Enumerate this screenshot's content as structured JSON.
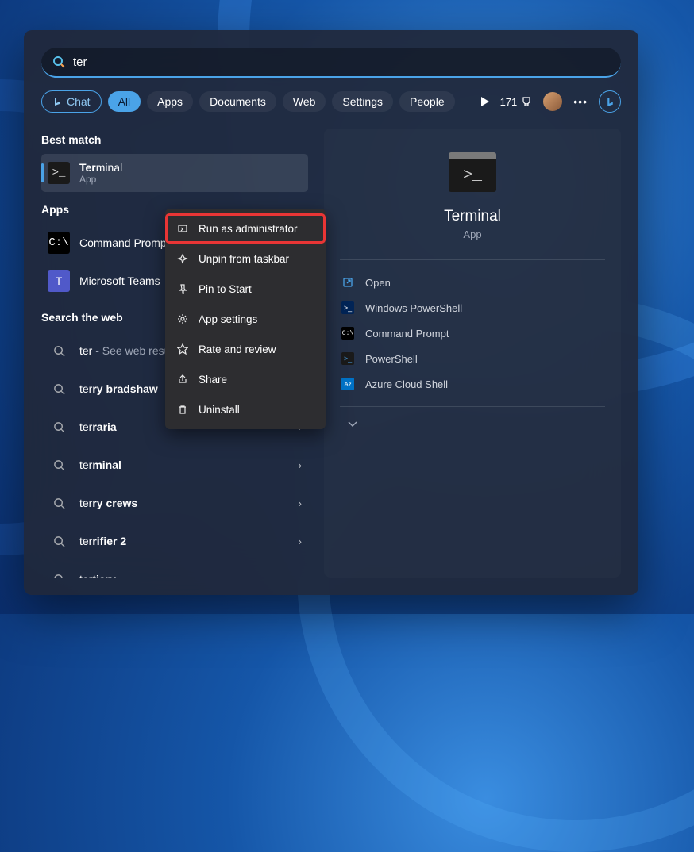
{
  "search": {
    "query": "ter"
  },
  "filters": {
    "chat": "Chat",
    "all": "All",
    "apps": "Apps",
    "documents": "Documents",
    "web": "Web",
    "settings": "Settings",
    "people": "People"
  },
  "header": {
    "points": "171"
  },
  "sections": {
    "best_match": "Best match",
    "apps": "Apps",
    "search_web": "Search the web"
  },
  "best_match": {
    "title_prefix": "Ter",
    "title_rest": "minal",
    "subtitle": "App"
  },
  "apps_results": [
    {
      "name": "Command Prompt",
      "icon": "cmd"
    },
    {
      "name": "Microsoft Teams",
      "icon": "teams"
    }
  ],
  "web_results": [
    {
      "prefix": "ter",
      "bold": "",
      "hint": " - See web results"
    },
    {
      "prefix": "ter",
      "bold": "ry bradshaw",
      "hint": ""
    },
    {
      "prefix": "ter",
      "bold": "raria",
      "hint": ""
    },
    {
      "prefix": "ter",
      "bold": "minal",
      "hint": ""
    },
    {
      "prefix": "ter",
      "bold": "ry crews",
      "hint": ""
    },
    {
      "prefix": "ter",
      "bold": "rifier 2",
      "hint": ""
    },
    {
      "prefix": "ter",
      "bold": "tiary",
      "hint": ""
    }
  ],
  "context_menu": [
    {
      "label": "Run as administrator",
      "icon": "admin",
      "highlighted": true
    },
    {
      "label": "Unpin from taskbar",
      "icon": "unpin",
      "highlighted": false
    },
    {
      "label": "Pin to Start",
      "icon": "pin",
      "highlighted": false
    },
    {
      "label": "App settings",
      "icon": "gear",
      "highlighted": false
    },
    {
      "label": "Rate and review",
      "icon": "star",
      "highlighted": false
    },
    {
      "label": "Share",
      "icon": "share",
      "highlighted": false
    },
    {
      "label": "Uninstall",
      "icon": "trash",
      "highlighted": false
    }
  ],
  "panel": {
    "title": "Terminal",
    "subtitle": "App",
    "actions": [
      {
        "label": "Open",
        "icon": "open"
      },
      {
        "label": "Windows PowerShell",
        "icon": "ps"
      },
      {
        "label": "Command Prompt",
        "icon": "cmd"
      },
      {
        "label": "PowerShell",
        "icon": "ps2"
      },
      {
        "label": "Azure Cloud Shell",
        "icon": "azure"
      }
    ]
  }
}
